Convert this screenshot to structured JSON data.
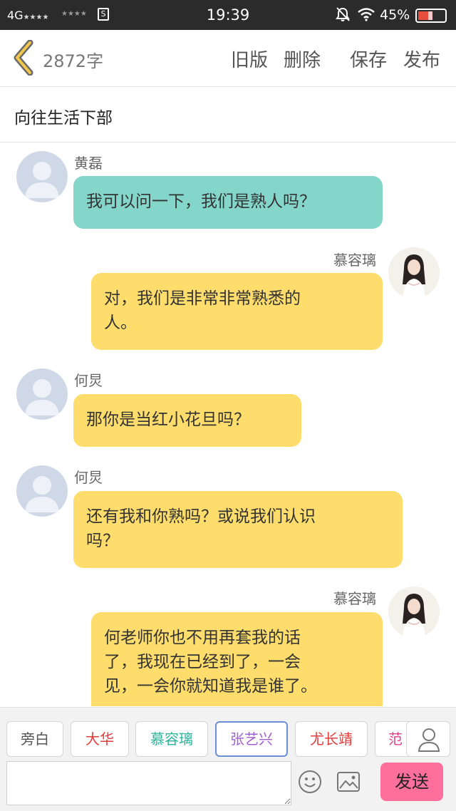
{
  "status_bar": {
    "network": "4G",
    "signal_stars": "★★★★",
    "signal2_stars": "★★★★",
    "sim_label": "S",
    "time": "19:39",
    "battery": "45%"
  },
  "toolbar": {
    "word_count": "2872字",
    "old_version": "旧版",
    "delete": "删除",
    "save": "保存",
    "publish": "发布"
  },
  "story": {
    "title": "向往生活下部"
  },
  "messages": [
    {
      "name": "黄磊",
      "side": "left",
      "avatar": "default",
      "color": "#84d6cb",
      "lines": [
        "我可以问一下，我们是熟人吗？"
      ]
    },
    {
      "name": "慕容璃",
      "side": "right",
      "avatar": "user",
      "color": "#fedd6c",
      "lines": [
        "对，我们是非常非常熟悉的",
        "人。"
      ]
    },
    {
      "name": "何炅",
      "side": "left",
      "avatar": "default",
      "color": "#fedd6c",
      "lines": [
        "那你是当红小花旦吗？"
      ]
    },
    {
      "name": "何炅",
      "side": "left",
      "avatar": "default",
      "color": "#fedd6c",
      "lines": [
        "还有我和你熟吗？或说我们认识",
        "吗？"
      ]
    },
    {
      "name": "慕容璃",
      "side": "right",
      "avatar": "user",
      "color": "#fedd6c",
      "lines": [
        "何老师你也不用再套我的话",
        "了，我现在已经到了，一会",
        "见，一会你就知道我是谁了。"
      ]
    }
  ],
  "roles": [
    {
      "label": "旁白",
      "color": "#555555"
    },
    {
      "label": "大华",
      "color": "#e03c3c"
    },
    {
      "label": "慕容璃",
      "color": "#2bb39b"
    },
    {
      "label": "张艺兴",
      "color": "#a35fd0"
    },
    {
      "label": "尤长靖",
      "color": "#e03c3c"
    },
    {
      "label": "范",
      "color": "#e0408a"
    }
  ],
  "input": {
    "placeholder": "",
    "send": "发送"
  },
  "icons": {
    "back": "chevron-left-icon",
    "emoji": "smiley-icon",
    "image": "image-icon",
    "role_user": "person-icon"
  }
}
